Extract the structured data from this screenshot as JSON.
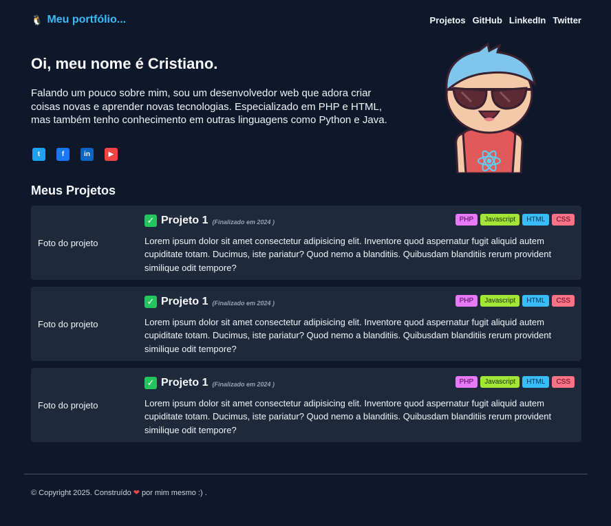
{
  "brand": {
    "emoji": "🐧",
    "label": "Meu portfólio..."
  },
  "nav": {
    "links": [
      "Projetos",
      "GitHub",
      "LinkedIn",
      "Twitter"
    ]
  },
  "hero": {
    "title": "Oi, meu nome é Cristiano.",
    "text": "Falando um pouco sobre mim, sou um desenvolvedor web que adora criar coisas novas e aprender novas tecnologias. Especializado em PHP e HTML, mas também tenho conhecimento em outras linguagens como Python e Java.",
    "social": [
      {
        "icon": "twitter-icon",
        "glyph": "t"
      },
      {
        "icon": "facebook-icon",
        "glyph": "f"
      },
      {
        "icon": "linkedin-icon",
        "glyph": "in"
      },
      {
        "icon": "youtube-icon",
        "glyph": "▶"
      }
    ]
  },
  "projects_section": {
    "title": "Meus Projetos",
    "items": [
      {
        "photo_label": "Foto do projeto",
        "check": "✓",
        "title": "Projeto 1",
        "status": "(Finalizado em 2024 )",
        "tags": [
          "PHP",
          "Javascript",
          "HTML",
          "CSS"
        ],
        "description": "Lorem ipsum dolor sit amet consectetur adipisicing elit. Inventore quod aspernatur fugit aliquid autem cupiditate totam. Ducimus, iste pariatur? Quod nemo a blanditiis. Quibusdam blanditiis rerum provident similique odit tempore?"
      },
      {
        "photo_label": "Foto do projeto",
        "check": "✓",
        "title": "Projeto 1",
        "status": "(Finalizado em 2024 )",
        "tags": [
          "PHP",
          "Javascript",
          "HTML",
          "CSS"
        ],
        "description": "Lorem ipsum dolor sit amet consectetur adipisicing elit. Inventore quod aspernatur fugit aliquid autem cupiditate totam. Ducimus, iste pariatur? Quod nemo a blanditiis. Quibusdam blanditiis rerum provident similique odit tempore?"
      },
      {
        "photo_label": "Foto do projeto",
        "check": "✓",
        "title": "Projeto 1",
        "status": "(Finalizado em 2024 )",
        "tags": [
          "PHP",
          "Javascript",
          "HTML",
          "CSS"
        ],
        "description": "Lorem ipsum dolor sit amet consectetur adipisicing elit. Inventore quod aspernatur fugit aliquid autem cupiditate totam. Ducimus, iste pariatur? Quod nemo a blanditiis. Quibusdam blanditiis rerum provident similique odit tempore?"
      }
    ]
  },
  "footer": {
    "before": "© Copyright 2025. Construído ",
    "heart": "❤",
    "after": " por mim mesmo :) ."
  },
  "colors": {
    "background": "#0f172a",
    "card": "#1e293b",
    "accent": "#38bdf8"
  }
}
